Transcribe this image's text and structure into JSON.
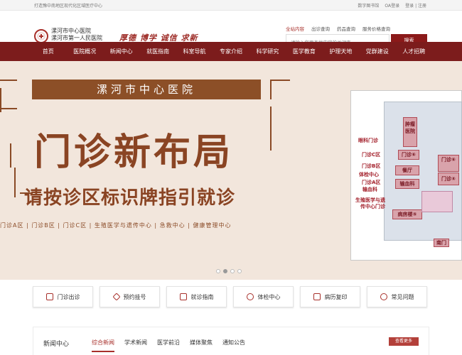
{
  "topbar": {
    "left_text": "打造豫中南地区现代化区域医疗中心",
    "links": [
      "数字图书馆",
      "OA登录",
      "登录 | 注册"
    ]
  },
  "header": {
    "logo_lines": [
      "漯河市中心医院",
      "漯河市第一人民医院"
    ],
    "slogan": "厚德 博学 诚信 求新",
    "search_tabs": [
      "全站内容",
      "出诊查询",
      "药品查询",
      "服务价格查询"
    ],
    "search_placeholder": "请输入您要查找内容的关键字",
    "search_button": "搜索"
  },
  "nav": {
    "items": [
      "首页",
      "医院概况",
      "新闻中心",
      "就医指南",
      "科室导航",
      "专家介绍",
      "科学研究",
      "医学教育",
      "护理天地",
      "党群建设",
      "人才招聘"
    ]
  },
  "banner": {
    "hospital_plate": "漯河市中心医院",
    "main_title": "门诊新布局",
    "sub_title": "请按诊区标识牌指引就诊",
    "zones": "门诊A区 | 门诊B区 | 门诊C区 | 生殖医学与遗传中心 | 急救中心 | 健康管理中心",
    "map_labels": [
      "眼科门诊",
      "门诊C区",
      "门诊B区",
      "体检中心",
      "门诊A区",
      "输血科",
      "生殖医学与遗传中心门诊"
    ],
    "map_rooms": [
      "肿瘤医院",
      "门诊⑥",
      "餐厅",
      "门诊④",
      "输血科",
      "病房楼⑤",
      "南门"
    ]
  },
  "carousel": {
    "slides": 4,
    "active": 2
  },
  "quick_links": [
    "门诊出诊",
    "预约挂号",
    "就诊指南",
    "体检中心",
    "病历复印",
    "常见问题"
  ],
  "news": {
    "title": "新闻中心",
    "tabs": [
      "综合新闻",
      "学术新闻",
      "医学前沿",
      "媒体聚焦",
      "通知公告"
    ],
    "more": "查看更多"
  },
  "colors": {
    "brand": "#7c1c1c",
    "accent": "#a8302b",
    "banner_bg": "#f2e6dc",
    "banner_brown": "#8a4423"
  }
}
